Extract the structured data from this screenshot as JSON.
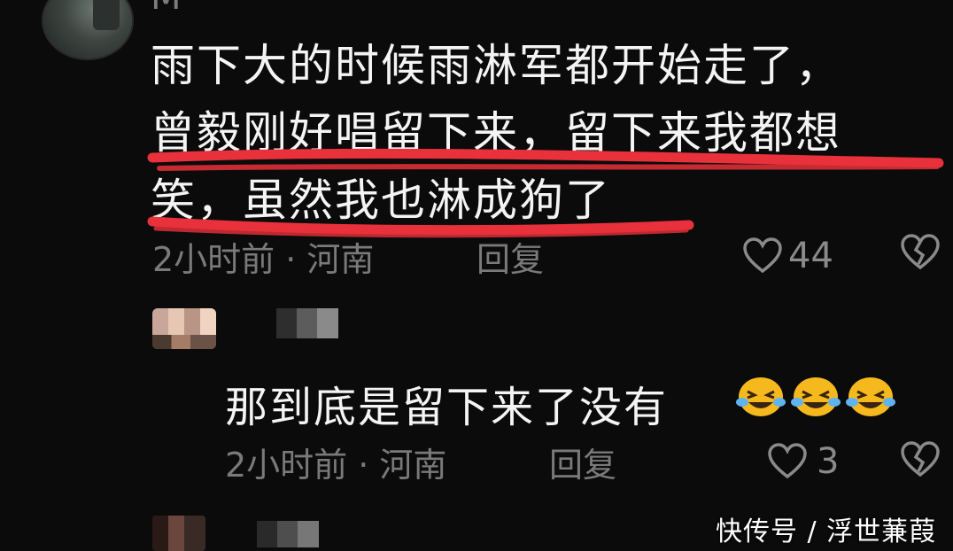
{
  "comment1": {
    "username": "M",
    "text_line1": "雨下大的时候雨淋军都开始走了，",
    "text_line2": "曾毅刚好唱留下来，留下来我都想",
    "text_line3": "笑，虽然我也淋成狗了",
    "time_location": "2小时前 · 河南",
    "reply_label": "回复",
    "like_count": "44"
  },
  "comment2": {
    "text": "那到底是留下来了没有",
    "emoji": "😂",
    "time_location": "2小时前 · 河南",
    "reply_label": "回复",
    "like_count": "3"
  },
  "watermark": "快传号 / 浮世蒹葭",
  "colors": {
    "background": "#0b0b0b",
    "text": "#f4f4f4",
    "meta": "#7a7a7a",
    "annotation": "#e8313a"
  }
}
